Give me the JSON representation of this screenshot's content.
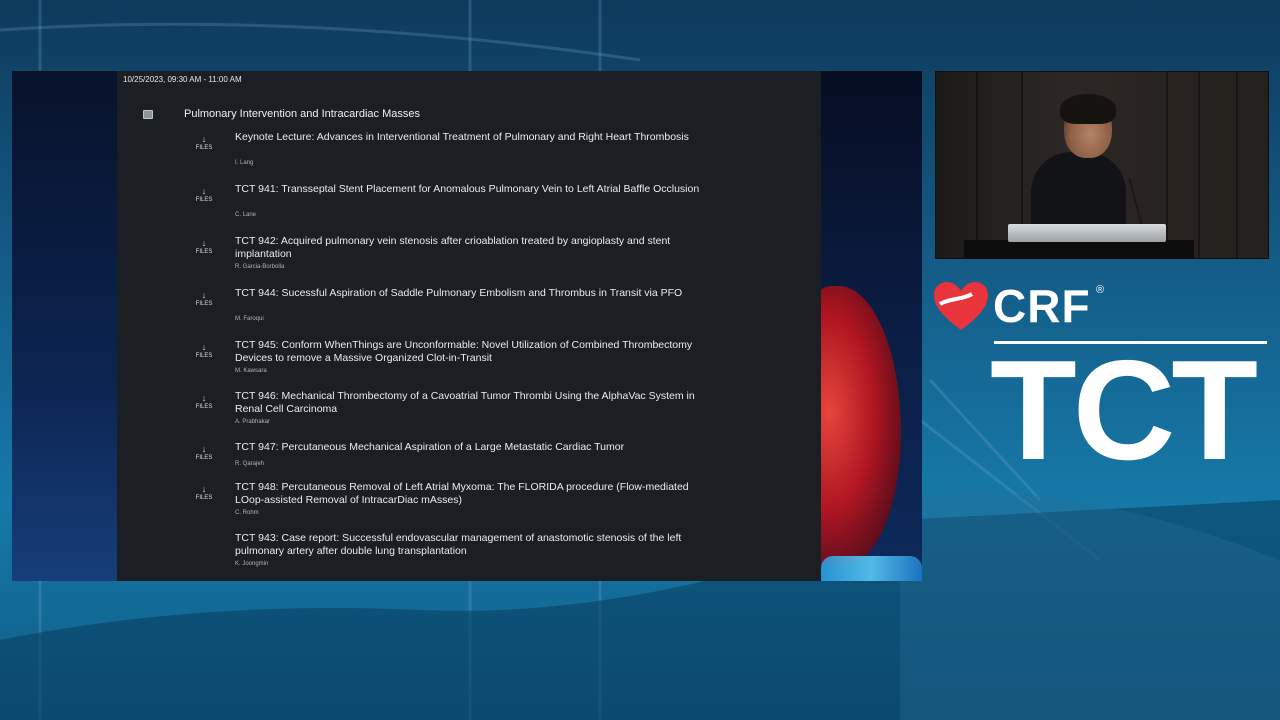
{
  "session": {
    "timestamp": "10/25/2023, 09:30 AM - 11:00 AM",
    "title": "Pulmonary Intervention and Intracardiac Masses",
    "files_label": "FILES",
    "items": [
      {
        "title": "Keynote Lecture: Advances in Interventional Treatment of Pulmonary and Right Heart Thrombosis",
        "author": "I. Lang",
        "has_files": true
      },
      {
        "title": "TCT 941: Transseptal Stent Placement for Anomalous Pulmonary Vein to Left Atrial Baffle Occlusion",
        "author": "C. Lane",
        "has_files": true
      },
      {
        "title": "TCT 942: Acquired pulmonary vein stenosis after crioablation treated by angioplasty and stent implantation",
        "author": "R. Garcia-Borbolla",
        "has_files": true
      },
      {
        "title": "TCT 944: Sucessful Aspiration of Saddle Pulmonary Embolism and Thrombus in Transit via PFO",
        "author": "M. Faroqui",
        "has_files": true
      },
      {
        "title": "TCT 945: Conform WhenThings are Unconformable: Novel Utilization of Combined Thrombectomy Devices to remove a Massive Organized Clot-in-Transit",
        "author": "M. Kawsara",
        "has_files": true
      },
      {
        "title": "TCT 946: Mechanical Thrombectomy of a Cavoatrial Tumor Thrombi Using the AlphaVac System in Renal Cell Carcinoma",
        "author": "A. Prabhakar",
        "has_files": true
      },
      {
        "title": "TCT 947: Percutaneous Mechanical Aspiration of a Large Metastatic Cardiac Tumor",
        "author": "R. Qarajeh",
        "has_files": true
      },
      {
        "title": "TCT 948: Percutaneous Removal of Left Atrial Myxoma: The FLORIDA procedure (Flow-mediated LOop-assisted Removal of IntracarDiac mAsses)",
        "author": "C. Rohm",
        "has_files": true
      },
      {
        "title": "TCT 943: Case report: Successful endovascular management of anastomotic stenosis of the left pulmonary artery after double lung transplantation",
        "author": "K. Joongmin",
        "has_files": false
      }
    ]
  },
  "branding": {
    "crf": "CRF",
    "registered": "®",
    "tct": "TCT",
    "accent_red": "#e8343a",
    "white": "#ffffff"
  },
  "icons": {
    "download": "download-arrow-icon",
    "session": "session-box-icon"
  }
}
